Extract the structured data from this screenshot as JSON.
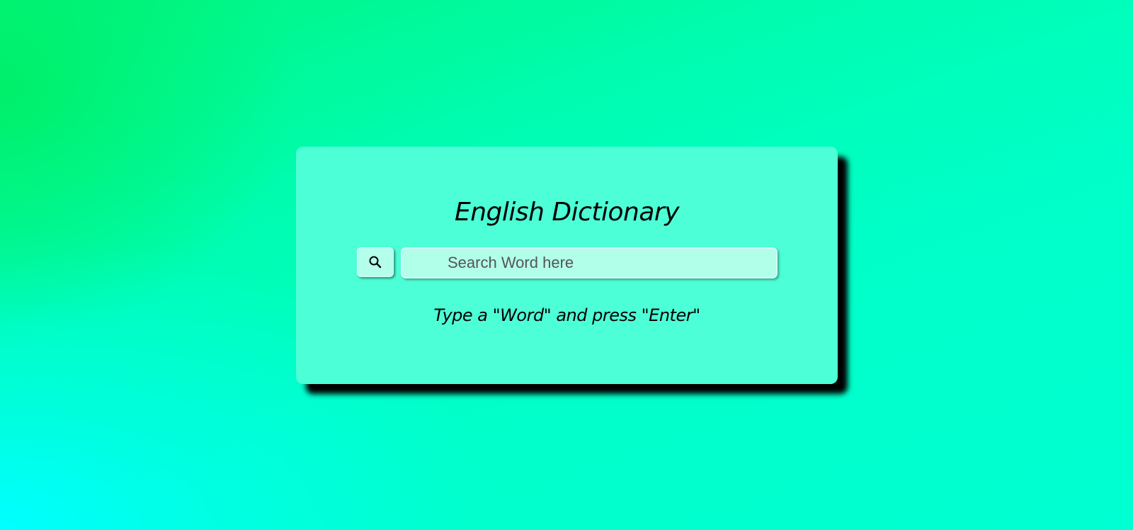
{
  "card": {
    "title": "English Dictionary",
    "hint": "Type a \"Word\" and press \"Enter\""
  },
  "search": {
    "placeholder": "Search Word here",
    "value": "",
    "button_icon": "search-icon"
  },
  "colors": {
    "card_background": "#4dffd6",
    "input_background": "#b2ffe9",
    "button_background": "#b4ffec",
    "shadow": "#000000",
    "page_gradient_green": "#00f06a",
    "page_gradient_cyan": "#00ffff",
    "page_gradient_mint": "#00ffc8"
  }
}
